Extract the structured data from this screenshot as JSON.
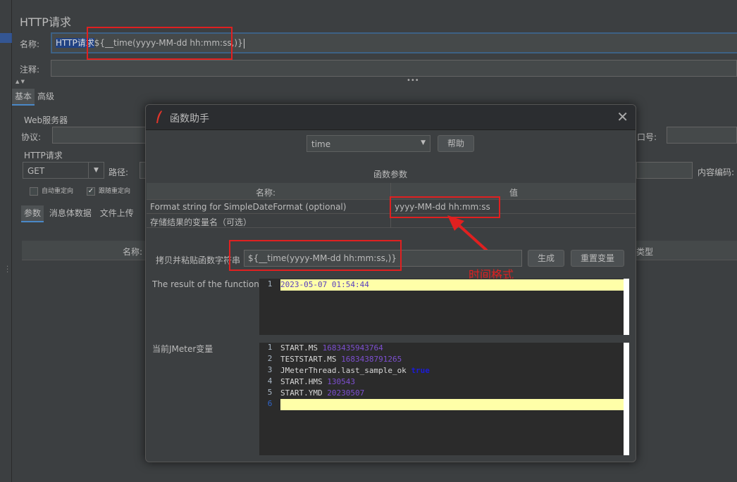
{
  "page": {
    "title": "HTTP请求"
  },
  "form": {
    "name_label": "名称:",
    "name_value_selected": "HTTP请求",
    "name_value_rest": "${__time(yyyy-MM-dd hh:mm:ss,)}",
    "comment_label": "注释:"
  },
  "tabs": [
    "基本",
    "高级"
  ],
  "web_server": {
    "title": "Web服务器",
    "protocol_label": "协议:",
    "port_label": "口号:"
  },
  "http_request": {
    "title": "HTTP请求",
    "method": "GET",
    "path_label": "路径:",
    "encoding_label": "内容编码:",
    "checkboxes": [
      {
        "label": "自动重定向",
        "checked": false
      },
      {
        "label": "跟随重定向",
        "checked": true
      }
    ]
  },
  "sub_tabs": [
    "参数",
    "消息体数据",
    "文件上传"
  ],
  "param_table": {
    "name_header": "名称:",
    "type_header": "类型"
  },
  "dialog": {
    "title": "函数助手",
    "function_select": "time",
    "help_button": "帮助",
    "params_title": "函数参数",
    "table_headers": [
      "名称:",
      "值"
    ],
    "rows": [
      {
        "name": "Format string for SimpleDateFormat (optional)",
        "value": "yyyy-MM-dd hh:mm:ss"
      },
      {
        "name": "存储结果的变量名（可选）",
        "value": ""
      }
    ],
    "copy_label": "拷贝并粘贴函数字符串",
    "function_string": "${__time(yyyy-MM-dd hh:mm:ss,)}",
    "generate_button": "生成",
    "reset_button": "重置变量",
    "result_label": "The result of the function is",
    "result_lines": [
      "2023-05-07 01:54:44"
    ],
    "vars_label": "当前JMeter变量",
    "vars_lines": [
      {
        "key": "START.MS",
        "value": "1683435943764"
      },
      {
        "key": "TESTSTART.MS",
        "value": "1683438791265"
      },
      {
        "key": "JMeterThread.last_sample_ok",
        "value": "true"
      },
      {
        "key": "START.HMS",
        "value": "130543"
      },
      {
        "key": "START.YMD",
        "value": "20230507"
      },
      {
        "key": "",
        "value": ""
      }
    ]
  },
  "annotation": {
    "text": "时间格式",
    "color": "#e02020"
  }
}
